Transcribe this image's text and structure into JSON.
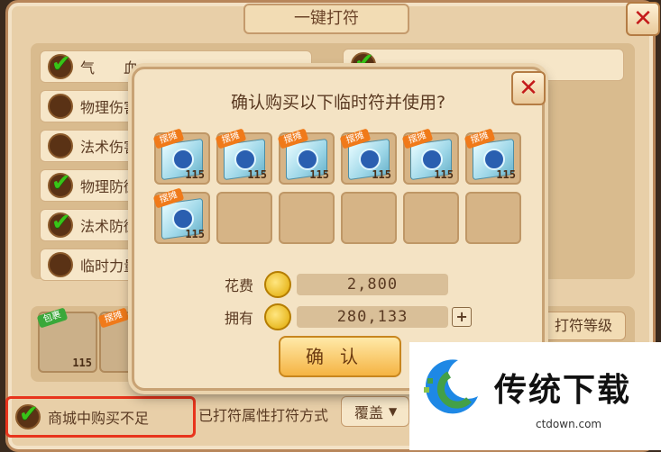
{
  "window": {
    "title": "一键打符",
    "close_icon": "close-icon"
  },
  "options": [
    {
      "label": "气　　血",
      "checked": true
    },
    {
      "label": "物理伤害",
      "checked": false
    },
    {
      "label": "法术伤害",
      "checked": false
    },
    {
      "label": "物理防御",
      "checked": true
    },
    {
      "label": "法术防御",
      "checked": true
    },
    {
      "label": "临时力量",
      "checked": false
    }
  ],
  "bottom": {
    "level_label": "打符等级",
    "shop_label": "商城中购买不足",
    "mode_label": "已打符属性打符方式",
    "mode_value": "覆盖",
    "mini_cards": [
      {
        "tag": "包裹",
        "level": "115"
      },
      {
        "tag": "摆摊",
        "level": "115"
      }
    ]
  },
  "dialog": {
    "title": "确认购买以下临时符并使用?",
    "close_icon": "close-icon",
    "items": [
      {
        "tag": "摆摊",
        "level": "115"
      },
      {
        "tag": "摆摊",
        "level": "115"
      },
      {
        "tag": "摆摊",
        "level": "115"
      },
      {
        "tag": "摆摊",
        "level": "115"
      },
      {
        "tag": "摆摊",
        "level": "115"
      },
      {
        "tag": "摆摊",
        "level": "115"
      },
      {
        "tag": "摆摊",
        "level": "115"
      }
    ],
    "empty_slots": 5,
    "cost_label": "花费",
    "cost_value": "2,800",
    "own_label": "拥有",
    "own_value": "280,133",
    "plus_label": "+",
    "confirm_label": "确认"
  },
  "watermark": {
    "title": "传统下载",
    "url": "ctdown.com"
  },
  "colors": {
    "accent": "#f5b443",
    "highlight_border": "#e8341c",
    "check_green": "#38c418"
  }
}
